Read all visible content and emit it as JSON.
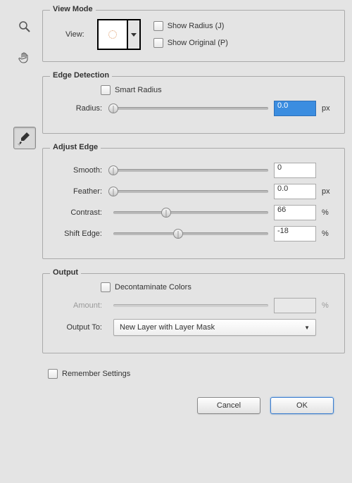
{
  "sections": {
    "viewMode": {
      "legend": "View Mode",
      "viewLabel": "View:",
      "showRadius": "Show Radius (J)",
      "showOriginal": "Show Original (P)"
    },
    "edgeDetection": {
      "legend": "Edge Detection",
      "smartRadius": "Smart Radius",
      "radiusLabel": "Radius:",
      "radiusValue": "0.0",
      "radiusUnit": "px"
    },
    "adjustEdge": {
      "legend": "Adjust Edge",
      "smoothLabel": "Smooth:",
      "smoothValue": "0",
      "featherLabel": "Feather:",
      "featherValue": "0.0",
      "featherUnit": "px",
      "contrastLabel": "Contrast:",
      "contrastValue": "66",
      "contrastUnit": "%",
      "shiftLabel": "Shift Edge:",
      "shiftValue": "-18",
      "shiftUnit": "%"
    },
    "output": {
      "legend": "Output",
      "decontaminate": "Decontaminate Colors",
      "amountLabel": "Amount:",
      "amountValue": "",
      "amountUnit": "%",
      "outputToLabel": "Output To:",
      "outputToValue": "New Layer with Layer Mask"
    }
  },
  "rememberSettings": "Remember Settings",
  "buttons": {
    "cancel": "Cancel",
    "ok": "OK"
  },
  "sliderPositions": {
    "radius": 0,
    "smooth": 0,
    "feather": 0,
    "contrast": 34,
    "shift": 42
  }
}
